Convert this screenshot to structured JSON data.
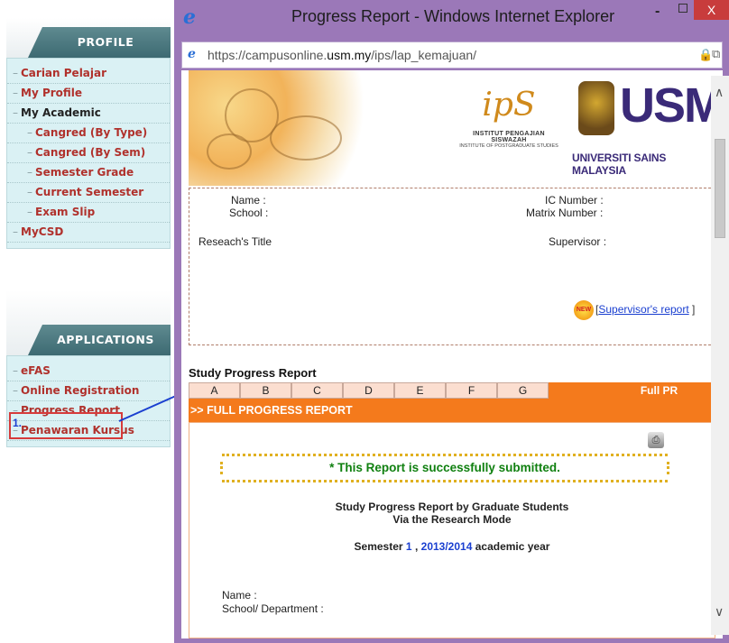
{
  "sidebar": {
    "profile_header": "PROFILE",
    "profile_items": [
      {
        "label": "Carian Pelajar",
        "level": 0
      },
      {
        "label": "My Profile",
        "level": 0
      },
      {
        "label": "My Academic",
        "level": 0,
        "dark": true
      },
      {
        "label": "Cangred (By Type)",
        "level": 1
      },
      {
        "label": "Cangred (By Sem)",
        "level": 1
      },
      {
        "label": "Semester Grade",
        "level": 1
      },
      {
        "label": "Current Semester",
        "level": 1
      },
      {
        "label": "Exam Slip",
        "level": 1
      },
      {
        "label": "MyCSD",
        "level": 0
      }
    ],
    "applications_header": "APPLICATIONS",
    "application_items": [
      {
        "label": "eFAS"
      },
      {
        "label": "Online Registration"
      },
      {
        "label": "Progress Report"
      },
      {
        "label": "Penawaran Kursus"
      }
    ],
    "annotation_number": "1."
  },
  "window": {
    "title": "Progress Report - Windows Internet Explorer",
    "min_glyph": "-",
    "close_glyph": "X"
  },
  "address": {
    "scheme": "https://campusonline.",
    "domain": "usm.my",
    "path": "/ips/lap_kemajuan/"
  },
  "banner": {
    "ips_name": "INSTITUT PENGAJIAN SISWAZAH",
    "ips_sub": "INSTITUTE OF POSTGRADUATE STUDIES",
    "usm_letters": "USM",
    "usm_name": "UNIVERSITI SAINS MALAYSIA"
  },
  "student_info": {
    "name_label": "Name :",
    "school_label": "School :",
    "ic_label": "IC Number :",
    "matrix_label": "Matrix Number :",
    "research_title_label": "Reseach's Title",
    "supervisor_label": "Supervisor :",
    "new_badge": "NEW",
    "supervisor_report_open": "[",
    "supervisor_report_link": "Supervisor's report",
    "supervisor_report_close": "]"
  },
  "study_progress": {
    "title": "Study Progress Report",
    "tabs": [
      "A",
      "B",
      "C",
      "D",
      "E",
      "F",
      "G"
    ],
    "full_tab": "Full PR",
    "section_bar": ">> FULL PROGRESS REPORT",
    "success_message": "* This Report is successfully submitted.",
    "heading_line1": "Study Progress Report by Graduate Students",
    "heading_line2": "Via the Research Mode",
    "semester_prefix": "Semester",
    "semester_number": "1",
    "semester_sep": ",",
    "academic_year": "2013/2014",
    "semester_suffix": "academic year",
    "name_label": "Name :",
    "department_label": "School/ Department :"
  },
  "colors": {
    "sidebar_item": "#b0312c",
    "orange_accent": "#f47a1c",
    "success_green": "#108010",
    "link_blue": "#1a3fd0",
    "window_frame": "#9b78b8"
  }
}
